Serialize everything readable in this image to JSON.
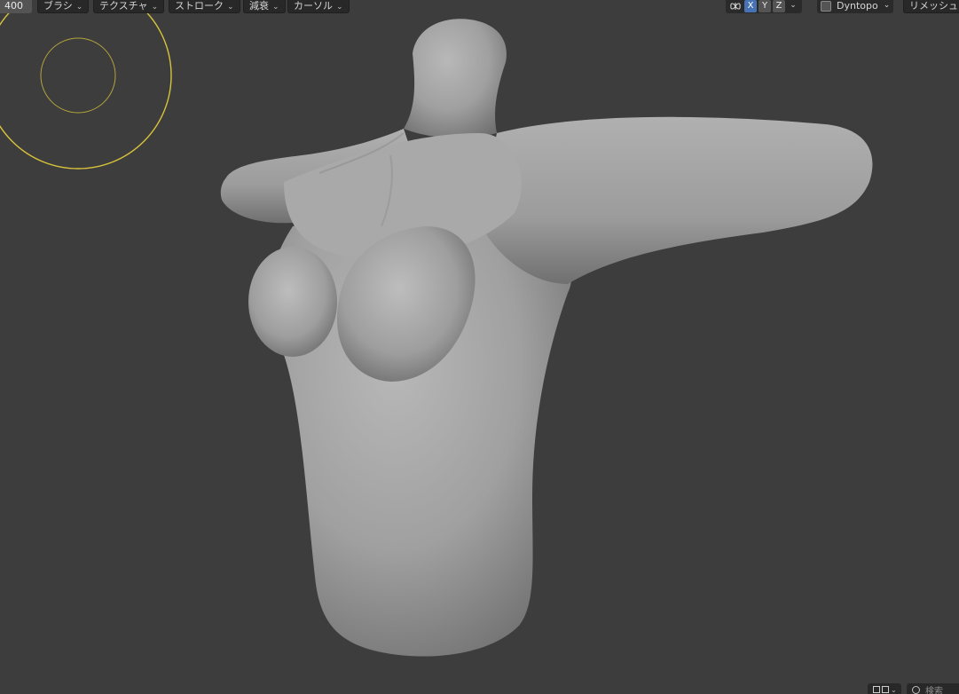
{
  "header": {
    "size_value": "400",
    "menus": [
      {
        "label": "ブラシ"
      },
      {
        "label": "テクスチャ"
      },
      {
        "label": "ストローク"
      },
      {
        "label": "減衰"
      },
      {
        "label": "カーソル"
      }
    ],
    "symmetry": {
      "icon": "butterfly-icon",
      "axes": [
        {
          "label": "X",
          "active": true
        },
        {
          "label": "Y",
          "active": false
        },
        {
          "label": "Z",
          "active": false
        }
      ]
    },
    "dyntopo": {
      "label": "Dyntopo",
      "checked": false
    },
    "remesh": {
      "label": "リメッシュ"
    }
  },
  "footer": {
    "search_placeholder": "検索"
  },
  "colors": {
    "viewport_bg": "#3d3d3d",
    "brush_cursor": "#d8c43a",
    "axis_active": "#4772b3",
    "mesh": "#a3a3a3"
  }
}
